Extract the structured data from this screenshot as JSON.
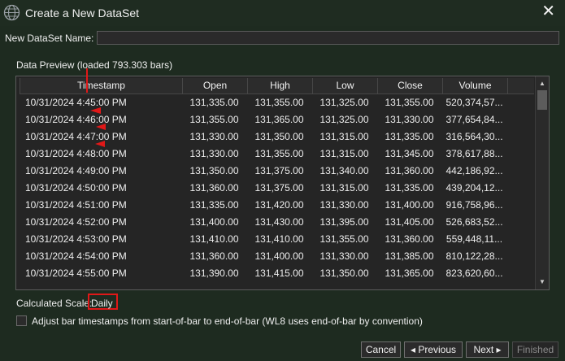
{
  "window": {
    "title": "Create a New DataSet",
    "close_glyph": "✕"
  },
  "form": {
    "name_label": "New DataSet Name:",
    "name_value": "",
    "preview_label": "Data Preview (loaded 793.303 bars)"
  },
  "table": {
    "columns": [
      "Timestamp",
      "Open",
      "High",
      "Low",
      "Close",
      "Volume"
    ],
    "rows": [
      [
        "10/31/2024 4:45:00 PM",
        "131,335.00",
        "131,355.00",
        "131,325.00",
        "131,355.00",
        "520,374,57..."
      ],
      [
        "10/31/2024 4:46:00 PM",
        "131,355.00",
        "131,365.00",
        "131,325.00",
        "131,330.00",
        "377,654,84..."
      ],
      [
        "10/31/2024 4:47:00 PM",
        "131,330.00",
        "131,350.00",
        "131,315.00",
        "131,335.00",
        "316,564,30..."
      ],
      [
        "10/31/2024 4:48:00 PM",
        "131,330.00",
        "131,355.00",
        "131,315.00",
        "131,345.00",
        "378,617,88..."
      ],
      [
        "10/31/2024 4:49:00 PM",
        "131,350.00",
        "131,375.00",
        "131,340.00",
        "131,360.00",
        "442,186,92..."
      ],
      [
        "10/31/2024 4:50:00 PM",
        "131,360.00",
        "131,375.00",
        "131,315.00",
        "131,335.00",
        "439,204,12..."
      ],
      [
        "10/31/2024 4:51:00 PM",
        "131,335.00",
        "131,420.00",
        "131,330.00",
        "131,400.00",
        "916,758,96..."
      ],
      [
        "10/31/2024 4:52:00 PM",
        "131,400.00",
        "131,430.00",
        "131,395.00",
        "131,405.00",
        "526,683,52..."
      ],
      [
        "10/31/2024 4:53:00 PM",
        "131,410.00",
        "131,410.00",
        "131,355.00",
        "131,360.00",
        "559,448,11..."
      ],
      [
        "10/31/2024 4:54:00 PM",
        "131,360.00",
        "131,400.00",
        "131,330.00",
        "131,385.00",
        "810,122,28..."
      ],
      [
        "10/31/2024 4:55:00 PM",
        "131,390.00",
        "131,415.00",
        "131,350.00",
        "131,365.00",
        "823,620,60..."
      ]
    ]
  },
  "scale": {
    "label": "Calculated Scale:",
    "value": "Daily"
  },
  "adjust": {
    "label": "Adjust bar timestamps from start-of-bar to end-of-bar (WL8 uses end-of-bar by convention)",
    "checked": false
  },
  "buttons": {
    "cancel": "Cancel",
    "previous": "◂ Previous",
    "next": "Next ▸",
    "finished": "Finished"
  },
  "colors": {
    "background": "#1e2b20",
    "grid_background": "#252525",
    "annotation_red": "#e01818"
  },
  "icons": {
    "app": "globe-icon",
    "close": "close-icon",
    "scroll_up": "scroll-up-arrow-icon",
    "scroll_down": "scroll-down-arrow-icon"
  }
}
